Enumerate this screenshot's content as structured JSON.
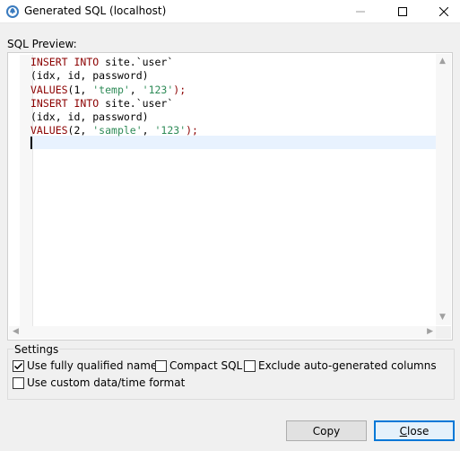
{
  "window": {
    "title": "Generated SQL (localhost)",
    "app_icon": "database-icon"
  },
  "preview": {
    "label": "SQL Preview:",
    "lines": [
      [
        {
          "t": "INSERT INTO ",
          "c": "kw"
        },
        {
          "t": "site.`user`",
          "c": "plain"
        }
      ],
      [
        {
          "t": "(idx, id, password)",
          "c": "plain"
        }
      ],
      [
        {
          "t": "VALUES",
          "c": "kw"
        },
        {
          "t": "(1, ",
          "c": "plain"
        },
        {
          "t": "'temp'",
          "c": "str"
        },
        {
          "t": ", ",
          "c": "plain"
        },
        {
          "t": "'123'",
          "c": "str"
        },
        {
          "t": ");",
          "c": "punc"
        }
      ],
      [
        {
          "t": "INSERT INTO ",
          "c": "kw"
        },
        {
          "t": "site.`user`",
          "c": "plain"
        }
      ],
      [
        {
          "t": "(idx, id, password)",
          "c": "plain"
        }
      ],
      [
        {
          "t": "VALUES",
          "c": "kw"
        },
        {
          "t": "(2, ",
          "c": "plain"
        },
        {
          "t": "'sample'",
          "c": "str"
        },
        {
          "t": ", ",
          "c": "plain"
        },
        {
          "t": "'123'",
          "c": "str"
        },
        {
          "t": ");",
          "c": "punc"
        }
      ]
    ]
  },
  "settings": {
    "label": "Settings",
    "options": {
      "qualified": {
        "label": "Use fully qualified names",
        "checked": true
      },
      "compact": {
        "label": "Compact SQL",
        "checked": false
      },
      "exclude_auto": {
        "label": "Exclude auto-generated columns",
        "checked": false
      },
      "custom_date": {
        "label": "Use custom data/time format",
        "checked": false
      }
    }
  },
  "buttons": {
    "copy": "Copy",
    "close_first": "C",
    "close_rest": "lose"
  },
  "colors": {
    "keyword": "#8b0000",
    "string": "#2e8b57",
    "accent": "#0078d7"
  }
}
